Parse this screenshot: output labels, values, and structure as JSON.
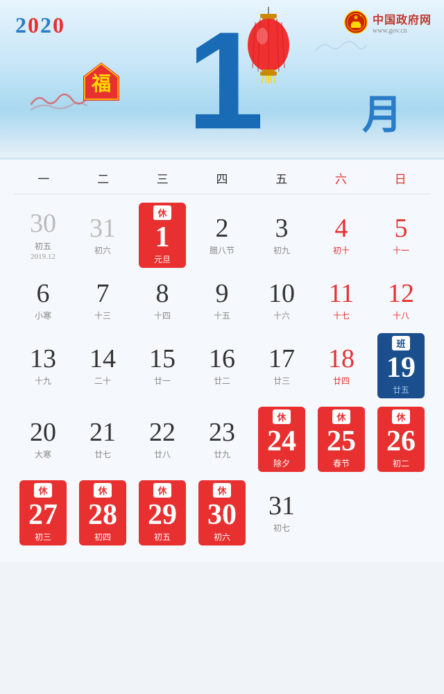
{
  "header": {
    "year": "2020",
    "month": "1",
    "yue": "月",
    "gov_title": "中国政府网",
    "gov_url": "www.gov.cn"
  },
  "weekdays": [
    {
      "label": "一",
      "weekend": false
    },
    {
      "label": "二",
      "weekend": false
    },
    {
      "label": "三",
      "weekend": false
    },
    {
      "label": "四",
      "weekend": false
    },
    {
      "label": "五",
      "weekend": false
    },
    {
      "label": "六",
      "weekend": true
    },
    {
      "label": "日",
      "weekend": true
    }
  ],
  "calendar": {
    "prev_month_label": "2019.12",
    "rows": [
      [
        {
          "day": "30",
          "lunar": "初五",
          "type": "prev",
          "col": 1
        },
        {
          "day": "31",
          "lunar": "初六",
          "type": "prev",
          "col": 2
        },
        {
          "day": "1",
          "lunar": "元旦",
          "type": "holiday",
          "badge": "休",
          "col": 3
        },
        {
          "day": "2",
          "lunar": "腊八节",
          "type": "normal",
          "col": 4
        },
        {
          "day": "3",
          "lunar": "初九",
          "type": "normal",
          "col": 5
        },
        {
          "day": "4",
          "lunar": "初十",
          "type": "weekend",
          "col": 6
        },
        {
          "day": "5",
          "lunar": "十一",
          "type": "weekend",
          "col": 7
        }
      ],
      [
        {
          "day": "6",
          "lunar": "小寒",
          "type": "normal",
          "col": 1
        },
        {
          "day": "7",
          "lunar": "十三",
          "type": "normal",
          "col": 2
        },
        {
          "day": "8",
          "lunar": "十四",
          "type": "normal",
          "col": 3
        },
        {
          "day": "9",
          "lunar": "十五",
          "type": "normal",
          "col": 4
        },
        {
          "day": "10",
          "lunar": "十六",
          "type": "normal",
          "col": 5
        },
        {
          "day": "11",
          "lunar": "十七",
          "type": "weekend",
          "col": 6
        },
        {
          "day": "12",
          "lunar": "十八",
          "type": "weekend",
          "col": 7
        }
      ],
      [
        {
          "day": "13",
          "lunar": "十九",
          "type": "normal",
          "col": 1
        },
        {
          "day": "14",
          "lunar": "二十",
          "type": "normal",
          "col": 2
        },
        {
          "day": "15",
          "lunar": "廿一",
          "type": "normal",
          "col": 3
        },
        {
          "day": "16",
          "lunar": "廿二",
          "type": "normal",
          "col": 4
        },
        {
          "day": "17",
          "lunar": "廿三",
          "type": "normal",
          "col": 5
        },
        {
          "day": "18",
          "lunar": "廿四",
          "type": "weekend",
          "col": 6
        },
        {
          "day": "19",
          "lunar": "廿五",
          "type": "work",
          "badge": "班",
          "col": 7
        }
      ],
      [
        {
          "day": "20",
          "lunar": "大寒",
          "type": "normal",
          "col": 1
        },
        {
          "day": "21",
          "lunar": "廿七",
          "type": "normal",
          "col": 2
        },
        {
          "day": "22",
          "lunar": "廿八",
          "type": "normal",
          "col": 3
        },
        {
          "day": "23",
          "lunar": "廿九",
          "type": "normal",
          "col": 4
        },
        {
          "day": "24",
          "lunar": "除夕",
          "type": "holiday",
          "badge": "休",
          "col": 5
        },
        {
          "day": "25",
          "lunar": "春节",
          "type": "holiday",
          "badge": "休",
          "col": 6
        },
        {
          "day": "26",
          "lunar": "初二",
          "type": "holiday",
          "badge": "休",
          "col": 7
        }
      ],
      [
        {
          "day": "27",
          "lunar": "初三",
          "type": "holiday",
          "badge": "休",
          "col": 1
        },
        {
          "day": "28",
          "lunar": "初四",
          "type": "holiday",
          "badge": "休",
          "col": 2
        },
        {
          "day": "29",
          "lunar": "初五",
          "type": "holiday",
          "badge": "休",
          "col": 3
        },
        {
          "day": "30",
          "lunar": "初六",
          "type": "holiday",
          "badge": "休",
          "col": 4
        },
        {
          "day": "31",
          "lunar": "初七",
          "type": "normal",
          "col": 5
        },
        null,
        null
      ]
    ]
  }
}
